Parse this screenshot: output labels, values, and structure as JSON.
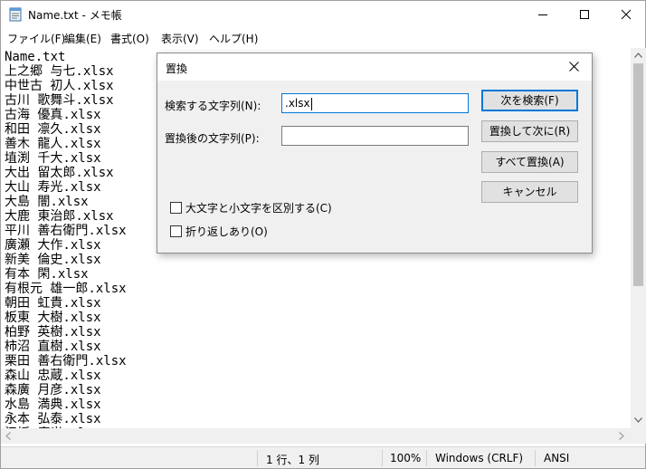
{
  "window": {
    "title": "Name.txt - メモ帳",
    "icon": "notepad-icon"
  },
  "menu": [
    {
      "label": "ファイル(F)"
    },
    {
      "label": "編集(E)"
    },
    {
      "label": "書式(O)"
    },
    {
      "label": "表示(V)"
    },
    {
      "label": "ヘルプ(H)"
    }
  ],
  "editor": {
    "lines": [
      "Name.txt",
      "上之郷 与七.xlsx",
      "中世古 初人.xlsx",
      "古川 歌舞斗.xlsx",
      "古海 優真.xlsx",
      "和田 凛久.xlsx",
      "善木 龍人.xlsx",
      "埴渕 千大.xlsx",
      "大出 留太郎.xlsx",
      "大山 寿光.xlsx",
      "大島 闇.xlsx",
      "大鹿 東治郎.xlsx",
      "平川 善右衛門.xlsx",
      "廣瀬 大作.xlsx",
      "新美 倫史.xlsx",
      "有本 閑.xlsx",
      "有根元 雄一郎.xlsx",
      "朝田 虹貴.xlsx",
      "板東 大樹.xlsx",
      "柏野 英樹.xlsx",
      "柿沼 直樹.xlsx",
      "栗田 善右衛門.xlsx",
      "森山 忠蔵.xlsx",
      "森廣 月彦.xlsx",
      "水島 満典.xlsx",
      "永本 弘泰.xlsx",
      "江坂 廣光.xlsx"
    ]
  },
  "status": {
    "position": "1 行、1 列",
    "zoom": "100%",
    "line_ending": "Windows (CRLF)",
    "encoding": "ANSI"
  },
  "dialog": {
    "title": "置換",
    "find_label": "検索する文字列(N):",
    "find_value": ".xlsx",
    "replace_label": "置換後の文字列(P):",
    "replace_value": "",
    "buttons": {
      "find_next": "次を検索(F)",
      "replace_next": "置換して次に(R)",
      "replace_all": "すべて置換(A)",
      "cancel": "キャンセル"
    },
    "options": {
      "match_case": {
        "label": "大文字と小文字を区別する(C)",
        "checked": false
      },
      "wrap_around": {
        "label": "折り返しあり(O)",
        "checked": false
      }
    }
  },
  "colors": {
    "accent": "#0078d7",
    "dialog_bg": "#f0f0f0",
    "button_bg": "#e1e1e1"
  }
}
